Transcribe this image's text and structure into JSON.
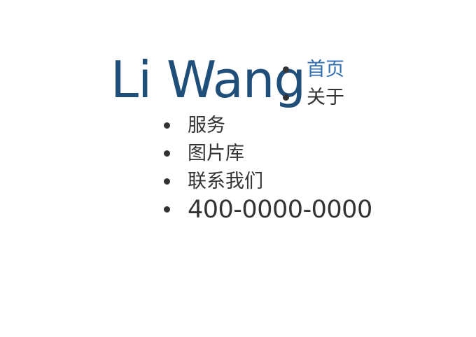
{
  "logo": {
    "text": "Li Wang"
  },
  "nav": {
    "items": [
      {
        "label": "首页",
        "active": true
      },
      {
        "label": "关于",
        "active": false
      },
      {
        "label": "服务",
        "active": false
      },
      {
        "label": "图片库",
        "active": false
      },
      {
        "label": "联系我们",
        "active": false
      }
    ],
    "phone": "400-0000-0000"
  },
  "colors": {
    "logo": "#1f4e79",
    "link_active": "#2f6db0",
    "text": "#333333",
    "background": "#ffffff"
  }
}
